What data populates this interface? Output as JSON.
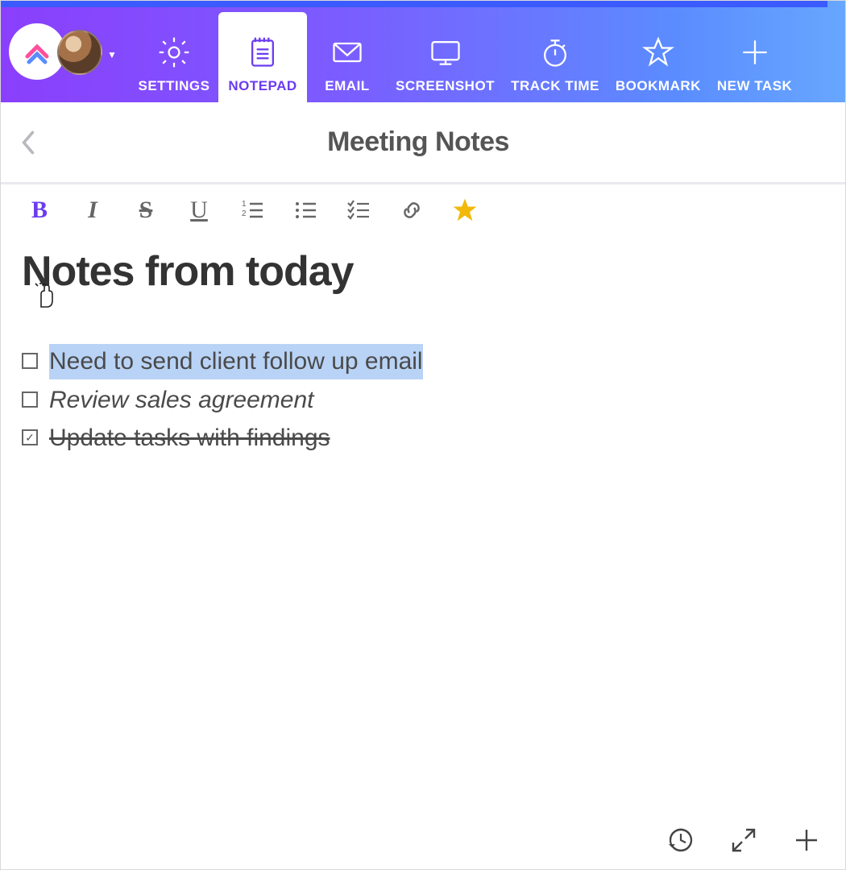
{
  "nav": {
    "items": [
      {
        "key": "settings",
        "label": "SETTINGS",
        "icon": "gear-icon"
      },
      {
        "key": "notepad",
        "label": "NOTEPAD",
        "icon": "notepad-icon",
        "active": true
      },
      {
        "key": "email",
        "label": "EMAIL",
        "icon": "envelope-icon"
      },
      {
        "key": "screenshot",
        "label": "SCREENSHOT",
        "icon": "monitor-icon"
      },
      {
        "key": "tracktime",
        "label": "TRACK TIME",
        "icon": "stopwatch-icon"
      },
      {
        "key": "bookmark",
        "label": "BOOKMARK",
        "icon": "star-icon"
      },
      {
        "key": "newtask",
        "label": "NEW TASK",
        "icon": "plus-icon"
      }
    ]
  },
  "page": {
    "title": "Meeting Notes"
  },
  "editor": {
    "heading": "Notes from today",
    "items": [
      {
        "text": "Need to send client follow up email",
        "checked": false,
        "highlighted": true,
        "italic": false,
        "strike": false
      },
      {
        "text": "Review sales agreement",
        "checked": false,
        "highlighted": false,
        "italic": true,
        "strike": false
      },
      {
        "text": "Update tasks with findings",
        "checked": true,
        "highlighted": false,
        "italic": false,
        "strike": true
      }
    ]
  },
  "format_toolbar": {
    "buttons": [
      {
        "key": "bold",
        "label": "B",
        "active": true
      },
      {
        "key": "italic",
        "label": "I"
      },
      {
        "key": "strike",
        "label": "S"
      },
      {
        "key": "underline",
        "label": "U"
      },
      {
        "key": "ordered",
        "label": "ordered-list-icon"
      },
      {
        "key": "bullet",
        "label": "bullet-list-icon"
      },
      {
        "key": "checklist",
        "label": "checklist-icon"
      },
      {
        "key": "link",
        "label": "link-icon"
      },
      {
        "key": "favorite",
        "label": "star-icon"
      }
    ]
  },
  "bottom_actions": {
    "history": "history-icon",
    "expand": "expand-icon",
    "add": "plus-icon"
  }
}
